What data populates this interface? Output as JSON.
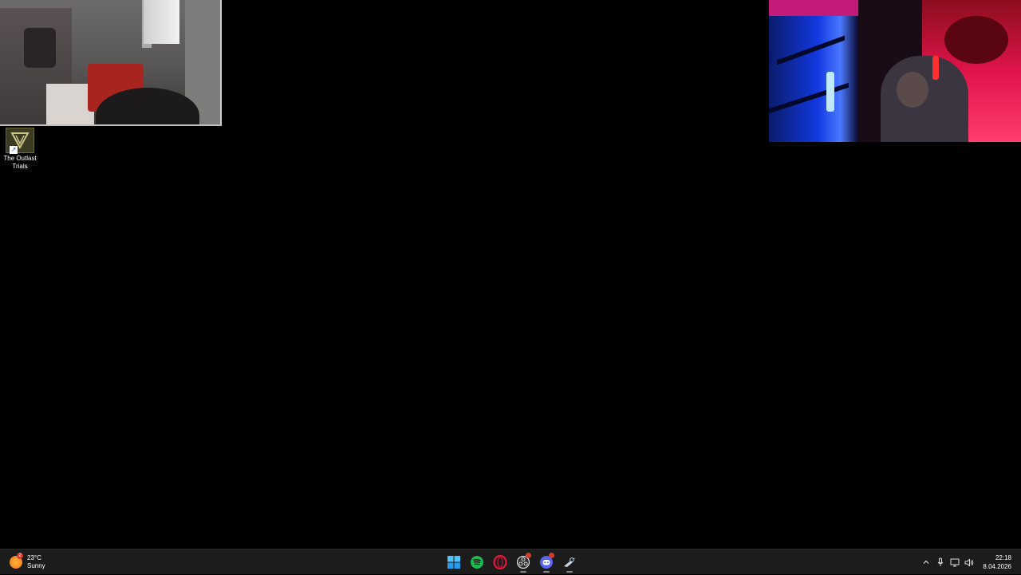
{
  "desktop": {
    "icons": [
      {
        "label": "The Outlast Trials"
      }
    ]
  },
  "webcams": {
    "left": {
      "description_label": ""
    },
    "right": {
      "description_label": ""
    }
  },
  "taskbar": {
    "weather": {
      "temperature": "23°C",
      "condition": "Sunny",
      "badge": "2",
      "icon": "sun-icon"
    },
    "apps": [
      {
        "name": "Start",
        "icon": "windows-start-icon"
      },
      {
        "name": "Spotify",
        "icon": "spotify-icon"
      },
      {
        "name": "Opera",
        "icon": "opera-icon"
      },
      {
        "name": "OBS",
        "icon": "obs-icon"
      },
      {
        "name": "Discord",
        "icon": "discord-icon"
      },
      {
        "name": "Steam",
        "icon": "steam-icon"
      }
    ],
    "tray": {
      "icons": [
        "chevron-up-icon",
        "microphone-icon",
        "network-icon",
        "speaker-icon"
      ]
    },
    "clock": {
      "time": "22:18",
      "date": "8.04.2026"
    }
  },
  "colors": {
    "taskbar_bg": "#1c1c1c",
    "desktop_bg": "#000000",
    "accent": "#1db954"
  }
}
